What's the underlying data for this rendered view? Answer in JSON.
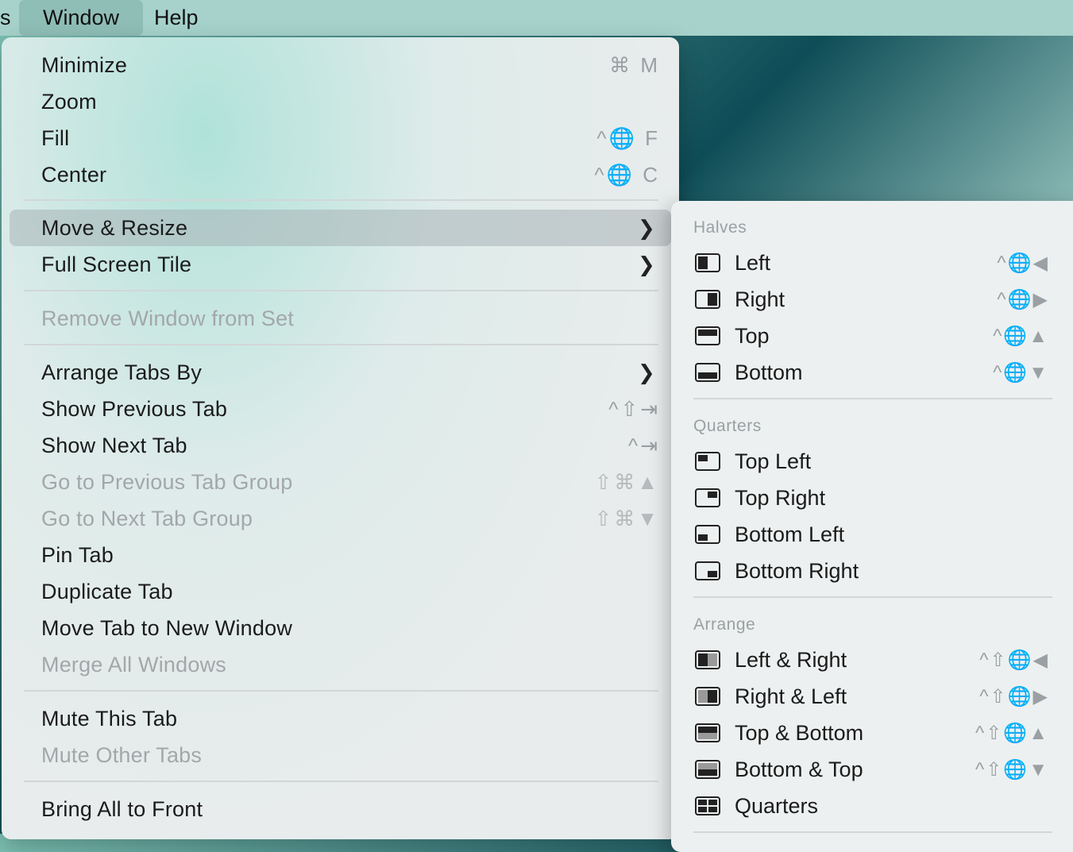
{
  "menubar": {
    "partial": "s",
    "window": "Window",
    "help": "Help"
  },
  "window_menu": {
    "items": [
      {
        "label": "Minimize",
        "shortcut": "⌘ M"
      },
      {
        "label": "Zoom",
        "shortcut": ""
      },
      {
        "label": "Fill",
        "shortcut": "^🌐 F"
      },
      {
        "label": "Center",
        "shortcut": "^🌐 C"
      },
      {
        "label": "Move & Resize"
      },
      {
        "label": "Full Screen Tile"
      },
      {
        "label": "Remove Window from Set"
      },
      {
        "label": "Arrange Tabs By"
      },
      {
        "label": "Show Previous Tab",
        "shortcut": "^⇧⇥"
      },
      {
        "label": "Show Next Tab",
        "shortcut": "^⇥"
      },
      {
        "label": "Go to Previous Tab Group",
        "shortcut": "⇧⌘▲"
      },
      {
        "label": "Go to Next Tab Group",
        "shortcut": "⇧⌘▼"
      },
      {
        "label": "Pin Tab"
      },
      {
        "label": "Duplicate Tab"
      },
      {
        "label": "Move Tab to New Window"
      },
      {
        "label": "Merge All Windows"
      },
      {
        "label": "Mute This Tab"
      },
      {
        "label": "Mute Other Tabs"
      },
      {
        "label": "Bring All to Front"
      }
    ]
  },
  "submenu": {
    "sections": {
      "halves": "Halves",
      "quarters": "Quarters",
      "arrange": "Arrange"
    },
    "items": [
      {
        "label": "Left",
        "shortcut": "^🌐◀",
        "icon": "half-left-icon"
      },
      {
        "label": "Right",
        "shortcut": "^🌐▶",
        "icon": "half-right-icon"
      },
      {
        "label": "Top",
        "shortcut": "^🌐▲",
        "icon": "half-top-icon"
      },
      {
        "label": "Bottom",
        "shortcut": "^🌐▼",
        "icon": "half-bottom-icon"
      },
      {
        "label": "Top Left",
        "icon": "quarter-top-left-icon"
      },
      {
        "label": "Top Right",
        "icon": "quarter-top-right-icon"
      },
      {
        "label": "Bottom Left",
        "icon": "quarter-bottom-left-icon"
      },
      {
        "label": "Bottom Right",
        "icon": "quarter-bottom-right-icon"
      },
      {
        "label": "Left & Right",
        "shortcut": "^⇧🌐◀",
        "icon": "left-right-icon"
      },
      {
        "label": "Right & Left",
        "shortcut": "^⇧🌐▶",
        "icon": "right-left-icon"
      },
      {
        "label": "Top & Bottom",
        "shortcut": "^⇧🌐▲",
        "icon": "top-bottom-icon"
      },
      {
        "label": "Bottom & Top",
        "shortcut": "^⇧🌐▼",
        "icon": "bottom-top-icon"
      },
      {
        "label": "Quarters",
        "icon": "quarters-grid-icon"
      }
    ]
  },
  "colors": {
    "menubar": "#a6d2cb",
    "highlight": "#c3cacc",
    "disabled_text": "#a3a7a9",
    "shortcut_text": "#9aa0a3"
  }
}
